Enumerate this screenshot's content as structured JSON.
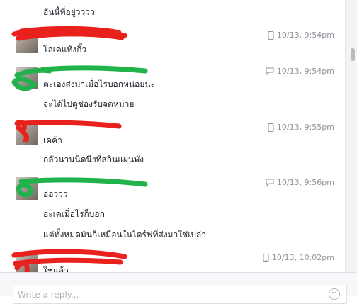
{
  "messages": [
    {
      "text": "อันนี้ที่อยู่วววว"
    },
    {
      "sender_redacted": true,
      "device": "mobile-phone-icon",
      "timestamp": "10/13, 9:54pm",
      "text": "โอเคแท้งกิ้ว"
    },
    {
      "sender_redacted": true,
      "device": "chat-bubble-icon",
      "timestamp": "10/13, 9:54pm",
      "text": "ตะเองส่งมาเมื่อไรบอกหน่อยนะ"
    },
    {
      "text": "จะได้ไปดูช่องรับจดหมาย"
    },
    {
      "sender_redacted": true,
      "device": "mobile-phone-icon",
      "timestamp": "10/13, 9:55pm",
      "text": "เคค้า"
    },
    {
      "text": "กลัวนานนิดนึงที่สกินแผ่นพัง"
    },
    {
      "sender_redacted": true,
      "device": "chat-bubble-icon",
      "timestamp": "10/13, 9:56pm",
      "text": "อ่อววว"
    },
    {
      "text": "อะเคเมื่อไรก็บอก"
    },
    {
      "text": "แต่ทั้งหมดมันก็เหมือนในไดร์ฟที่ส่งมาใช่เปล่า"
    },
    {
      "sender_redacted": true,
      "device": "mobile-phone-icon",
      "timestamp": "10/13, 10:02pm",
      "text": "ใช่แล้ว"
    }
  ],
  "composer": {
    "placeholder": "Write a reply..."
  },
  "colors": {
    "redaction_red": "#e8211c",
    "redaction_green": "#22b24c",
    "meta_gray": "#90949c"
  }
}
